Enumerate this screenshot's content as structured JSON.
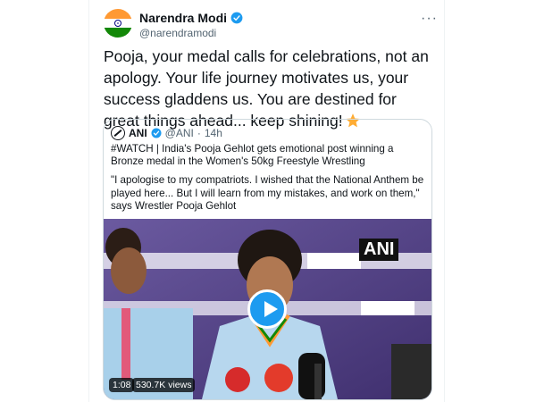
{
  "tweet": {
    "author_name": "Narendra Modi",
    "author_handle": "@narendramodi",
    "text": "Pooja, your medal calls for celebrations, not an apology. Your life journey motivates us, your success gladdens us. You are destined for great things ahead... keep shining!",
    "star_icon": "star-emoji",
    "more_label": "···"
  },
  "quote": {
    "author_name": "ANI",
    "author_handle": "@ANI",
    "separator": "·",
    "time": "14h",
    "paragraph1": "#WATCH | India's Pooja Gehlot gets emotional post winning a Bronze medal in the Women's 50kg Freestyle Wrestling",
    "paragraph2": "\"I apologise to my compatriots. I wished that the National Anthem be played here... But I will learn from my mistakes, and work on them,\" says Wrestler Pooja Gehlot"
  },
  "video": {
    "duration": "1:08",
    "views": "530.7K views",
    "watermark": "ANI",
    "colors": {
      "backdrop": "#5a4a8a",
      "jacket": "#b7d7ee",
      "play": "#1d9bf0"
    }
  },
  "colors": {
    "verified": "#1d9bf0",
    "text": "#0f1419",
    "secondary": "#536471",
    "border": "#cfd9de"
  }
}
